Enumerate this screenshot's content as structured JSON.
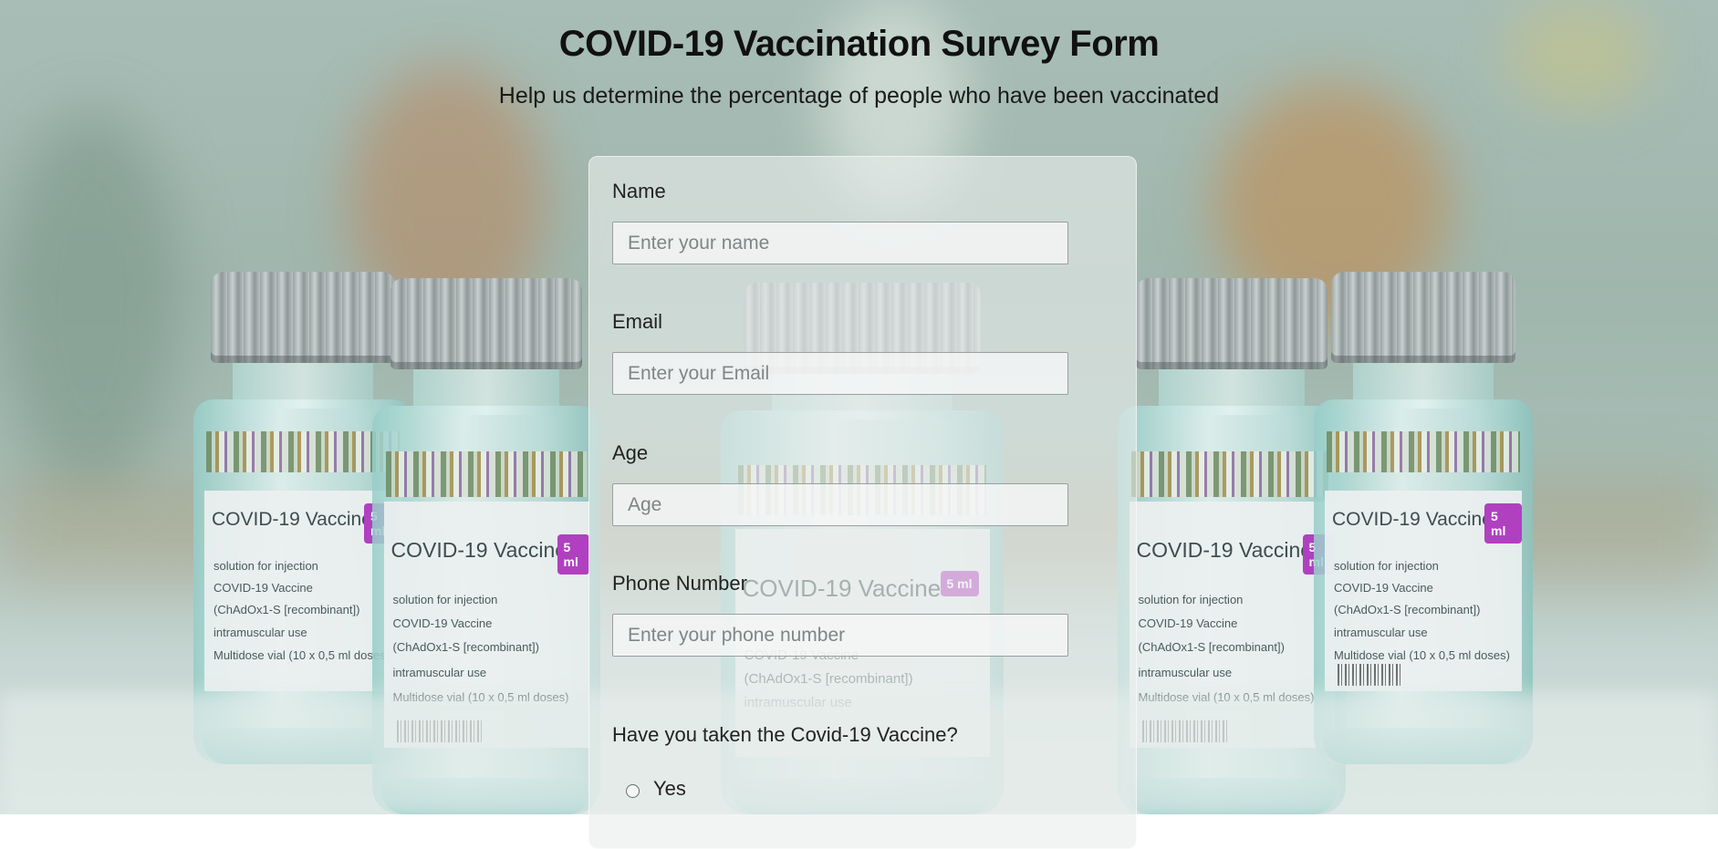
{
  "header": {
    "title": "COVID-19 Vaccination Survey Form",
    "subtitle": "Help us determine the percentage of people who have been vaccinated"
  },
  "form": {
    "name": {
      "label": "Name",
      "placeholder": "Enter your name",
      "value": ""
    },
    "email": {
      "label": "Email",
      "placeholder": "Enter your Email",
      "value": ""
    },
    "age": {
      "label": "Age",
      "placeholder": "Age",
      "value": ""
    },
    "phone": {
      "label": "Phone Number",
      "placeholder": "Enter your phone number",
      "value": ""
    },
    "vaccine_question": {
      "label": "Have you taken the Covid-19 Vaccine?",
      "options": [
        {
          "label": "Yes",
          "selected": false
        }
      ]
    }
  },
  "background": {
    "vial_label_text": "COVID-19 Vaccine",
    "vial_tag": "5 ml",
    "vial_lines": [
      "solution for injection",
      "COVID-19 Vaccine",
      "(ChAdOx1-S [recombinant])",
      "intramuscular use",
      "Multidose vial (10 x 0,5 ml doses)"
    ]
  },
  "colors": {
    "backdrop": "#a8bdb6",
    "card": "#e8edec",
    "vial_tag": "#b040c0"
  }
}
